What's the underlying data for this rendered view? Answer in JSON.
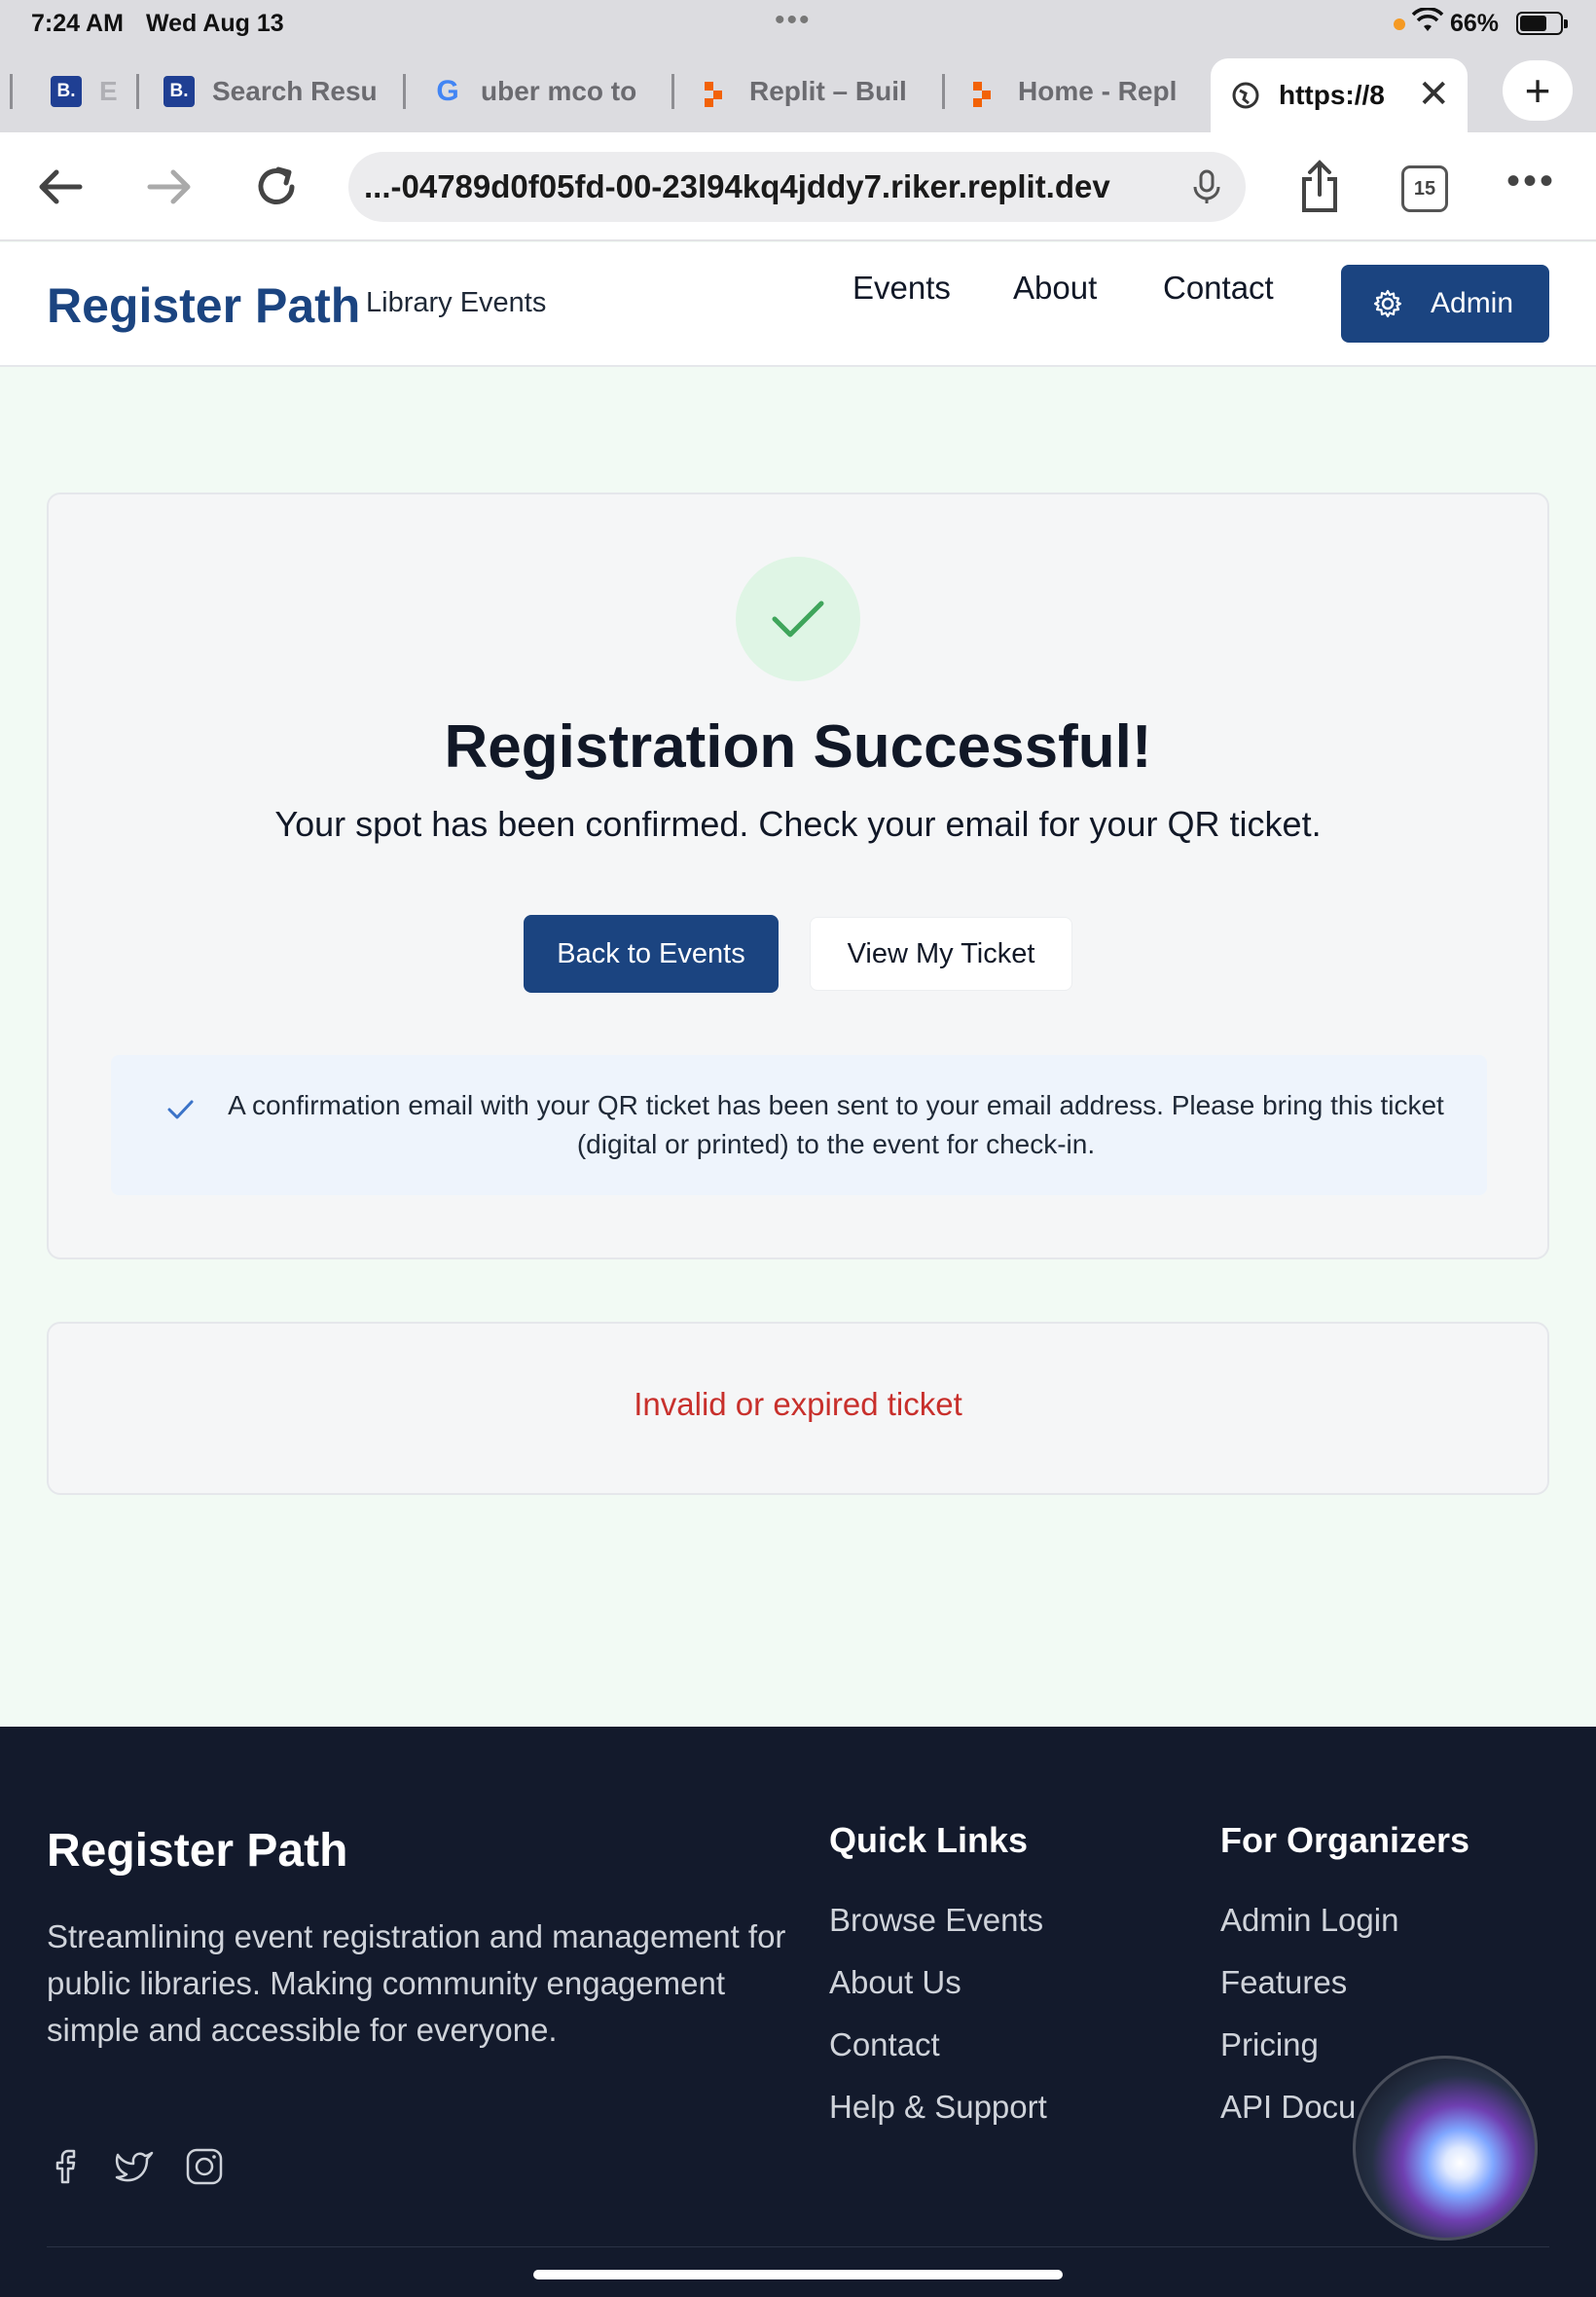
{
  "status_bar": {
    "time": "7:24 AM",
    "date": "Wed Aug 13",
    "battery": "66%"
  },
  "tabs": [
    {
      "label": "B.",
      "title": "E",
      "favicon": "booking-icon"
    },
    {
      "label": "B.",
      "title": "Search Resu",
      "favicon": "booking-icon"
    },
    {
      "title": "uber mco to",
      "favicon": "google-icon"
    },
    {
      "title": "Replit – Buil",
      "favicon": "replit-icon"
    },
    {
      "title": "Home - Repl",
      "favicon": "replit-icon"
    },
    {
      "title": "https://8",
      "favicon": "globe-icon",
      "active": true
    }
  ],
  "browser": {
    "url": "...-04789d0f05fd-00-23l94kq4jddy7.riker.replit.dev",
    "tab_count": "15"
  },
  "header": {
    "brand": "Register Path",
    "subtitle": "Library Events",
    "nav": [
      "Events",
      "About",
      "Contact"
    ],
    "admin_label": "Admin"
  },
  "success_card": {
    "title": "Registration Successful!",
    "subtitle": "Your spot has been confirmed. Check your email for your QR ticket.",
    "primary_button": "Back to Events",
    "secondary_button": "View My Ticket",
    "notice": "A confirmation email with your QR ticket has been sent to your email address. Please bring this ticket (digital or printed) to the event for check-in."
  },
  "error_card": {
    "message": "Invalid or expired ticket"
  },
  "footer": {
    "brand": "Register Path",
    "description": "Streamlining event registration and management for public libraries. Making community engagement simple and accessible for everyone.",
    "quick_links": {
      "heading": "Quick Links",
      "items": [
        "Browse Events",
        "About Us",
        "Contact",
        "Help & Support"
      ]
    },
    "organizers": {
      "heading": "For Organizers",
      "items": [
        "Admin Login",
        "Features",
        "Pricing",
        "API Docu"
      ]
    },
    "social_icons": [
      "facebook-icon",
      "twitter-icon",
      "instagram-icon"
    ]
  },
  "colors": {
    "primary": "#1b4480",
    "success_bg": "#dff5e5",
    "success_check": "#3fa55b",
    "error": "#c8302c",
    "footer_bg": "#131a2c",
    "page_bg": "#f2faf4"
  }
}
